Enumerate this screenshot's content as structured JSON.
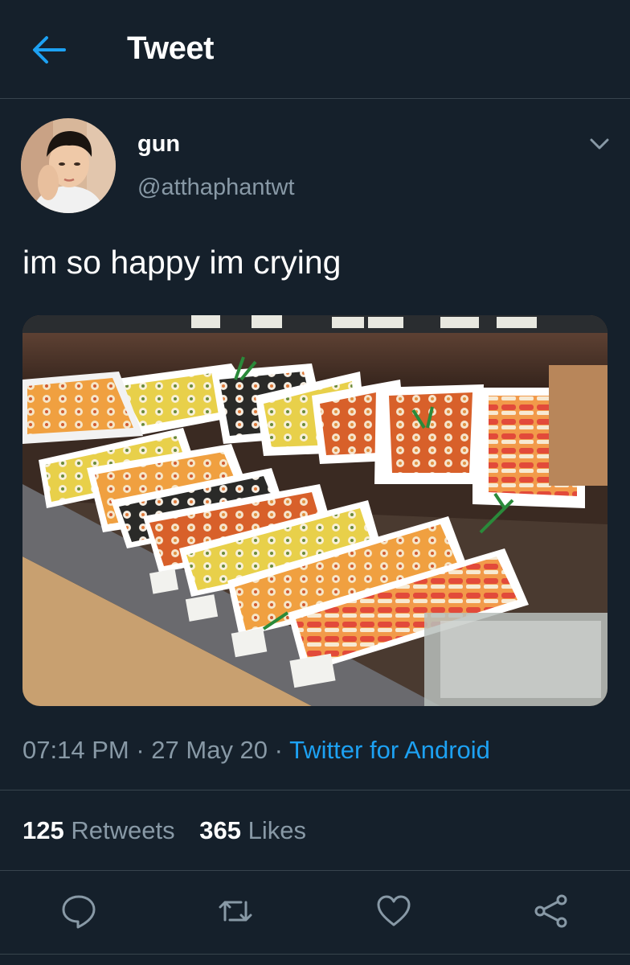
{
  "header": {
    "title": "Tweet",
    "back_icon": "arrow-left-icon"
  },
  "tweet": {
    "author": {
      "name": "gun",
      "handle": "@atthaphantwt"
    },
    "text": "im so happy im crying",
    "time": "07:14 PM",
    "date": "27 May 20",
    "separator": "·",
    "source": "Twitter for Android",
    "retweets": {
      "count": "125",
      "label": "Retweets"
    },
    "likes": {
      "count": "365",
      "label": "Likes"
    }
  },
  "actions": [
    "reply-icon",
    "retweet-icon",
    "like-icon",
    "share-icon"
  ],
  "colors": {
    "background": "#15202b",
    "accent": "#1da1f2",
    "secondary_text": "#8899a6",
    "divider": "#38444d"
  }
}
